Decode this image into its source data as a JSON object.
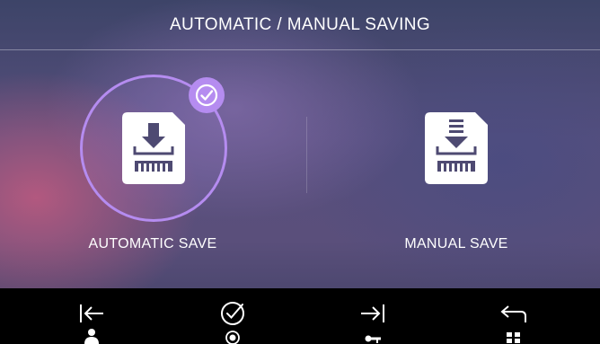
{
  "header": {
    "title": "AUTOMATIC / MANUAL SAVING"
  },
  "options": [
    {
      "label": "AUTOMATIC SAVE",
      "icon": "sd-card-download-icon",
      "selected": true
    },
    {
      "label": "MANUAL SAVE",
      "icon": "sd-card-save-icon",
      "selected": false
    }
  ],
  "colors": {
    "accent": "#b58cf0",
    "text": "#ffffff",
    "nav_bg": "#000000"
  },
  "nav": [
    {
      "icon": "arrow-to-start-icon",
      "sub_icon": "user-icon"
    },
    {
      "icon": "checkmark-circle-icon",
      "sub_icon": "record-icon"
    },
    {
      "icon": "arrow-to-end-icon",
      "sub_icon": "key-icon"
    },
    {
      "icon": "back-arrow-icon",
      "sub_icon": "grid-icon"
    }
  ]
}
